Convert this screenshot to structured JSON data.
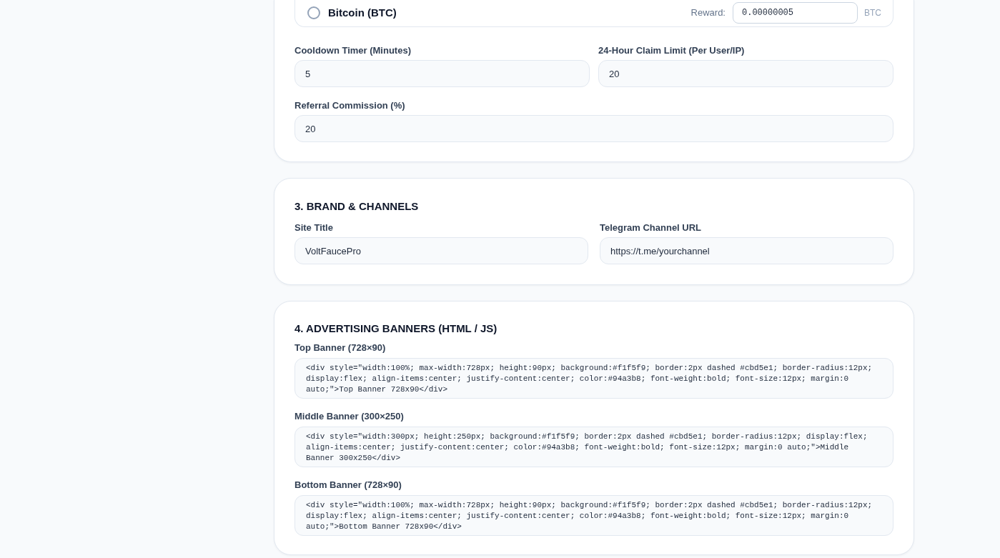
{
  "coin_option": {
    "name": "Bitcoin (BTC)",
    "selected": false,
    "reward_label": "Reward:",
    "reward_value": "0.00000005",
    "unit": "BTC"
  },
  "faucet_settings": {
    "rows": [
      [
        {
          "label": "Cooldown Timer (Minutes)",
          "value": "5"
        },
        {
          "label": "24-Hour Claim Limit (Per User/IP)",
          "value": "20"
        }
      ],
      [
        {
          "label": "Referral Commission (%)",
          "value": "20"
        }
      ]
    ]
  },
  "brand_channels": {
    "heading": "3. BRAND & CHANNELS",
    "rows": [
      [
        {
          "label": "Site Title",
          "value": "VoltFaucePro"
        },
        {
          "label": "Telegram Channel URL",
          "value": "https://t.me/yourchannel"
        }
      ]
    ]
  },
  "advertising_banners": {
    "heading": "4. ADVERTISING BANNERS (HTML / JS)",
    "fields": [
      {
        "label": "Top Banner (728×90)",
        "value": "<div style=\"width:100%; max-width:728px; height:90px; background:#f1f5f9; border:2px dashed #cbd5e1; border-radius:12px; display:flex; align-items:center; justify-content:center; color:#94a3b8; font-weight:bold; font-size:12px; margin:0 auto;\">Top Banner 728x90</div>"
      },
      {
        "label": "Middle Banner (300×250)",
        "value": "<div style=\"width:300px; height:250px; background:#f1f5f9; border:2px dashed #cbd5e1; border-radius:12px; display:flex; align-items:center; justify-content:center; color:#94a3b8; font-weight:bold; font-size:12px; margin:0 auto;\">Middle Banner 300x250</div>"
      },
      {
        "label": "Bottom Banner (728×90)",
        "value": "<div style=\"width:100%; max-width:728px; height:90px; background:#f1f5f9; border:2px dashed #cbd5e1; border-radius:12px; display:flex; align-items:center; justify-content:center; color:#94a3b8; font-weight:bold; font-size:12px; margin:0 auto;\">Bottom Banner 728x90</div>"
      }
    ]
  }
}
